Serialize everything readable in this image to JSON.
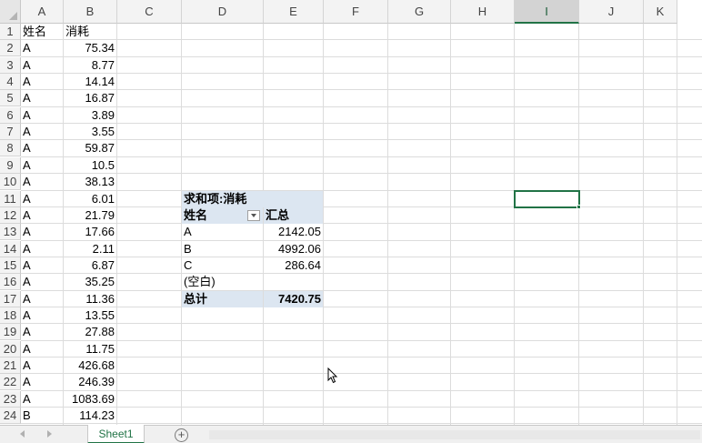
{
  "columns": [
    "A",
    "B",
    "C",
    "D",
    "E",
    "F",
    "G",
    "H",
    "I",
    "J",
    "K"
  ],
  "selected_column": "I",
  "rows": [
    1,
    2,
    3,
    4,
    5,
    6,
    7,
    8,
    9,
    10,
    11,
    12,
    13,
    14,
    15,
    16,
    17,
    18,
    19,
    20,
    21,
    22,
    23,
    24
  ],
  "header": {
    "name": "姓名",
    "consumption": "消耗"
  },
  "data_rows": [
    {
      "name": "A",
      "value": "75.34"
    },
    {
      "name": "A",
      "value": "8.77"
    },
    {
      "name": "A",
      "value": "14.14"
    },
    {
      "name": "A",
      "value": "16.87"
    },
    {
      "name": "A",
      "value": "3.89"
    },
    {
      "name": "A",
      "value": "3.55"
    },
    {
      "name": "A",
      "value": "59.87"
    },
    {
      "name": "A",
      "value": "10.5"
    },
    {
      "name": "A",
      "value": "38.13"
    },
    {
      "name": "A",
      "value": "6.01"
    },
    {
      "name": "A",
      "value": "21.79"
    },
    {
      "name": "A",
      "value": "17.66"
    },
    {
      "name": "A",
      "value": "2.11"
    },
    {
      "name": "A",
      "value": "6.87"
    },
    {
      "name": "A",
      "value": "35.25"
    },
    {
      "name": "A",
      "value": "11.36"
    },
    {
      "name": "A",
      "value": "13.55"
    },
    {
      "name": "A",
      "value": "27.88"
    },
    {
      "name": "A",
      "value": "11.75"
    },
    {
      "name": "A",
      "value": "426.68"
    },
    {
      "name": "A",
      "value": "246.39"
    },
    {
      "name": "A",
      "value": "1083.69"
    },
    {
      "name": "B",
      "value": "114.23"
    }
  ],
  "pivot": {
    "title": "求和项:消耗",
    "row_label": "姓名",
    "value_label": "汇总",
    "rows": [
      {
        "label": "A",
        "value": "2142.05"
      },
      {
        "label": "B",
        "value": "4992.06"
      },
      {
        "label": "C",
        "value": "286.64"
      },
      {
        "label": "(空白)",
        "value": ""
      }
    ],
    "total_label": "总计",
    "total_value": "7420.75"
  },
  "sheet_tab": "Sheet1",
  "add_sheet_symbol": "+",
  "accent_color": "#217346",
  "pivot_header_color": "#dce6f1"
}
